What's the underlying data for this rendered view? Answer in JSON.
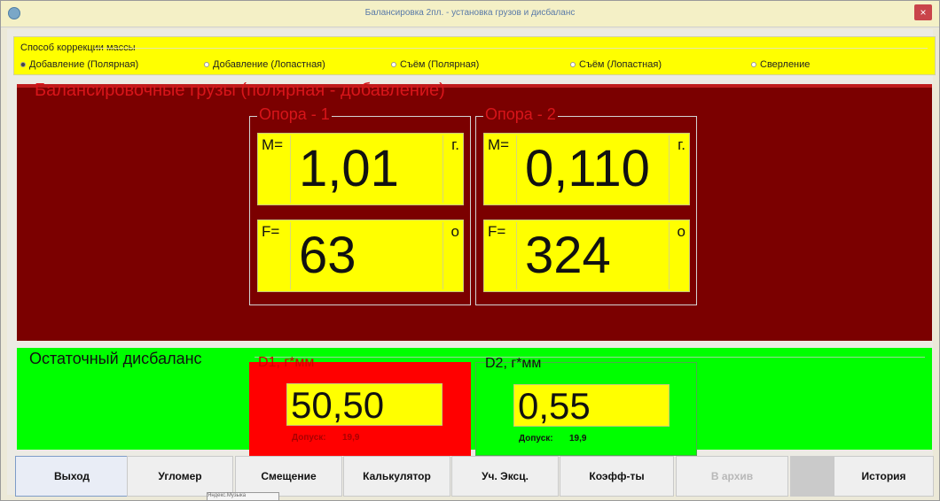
{
  "window": {
    "title": "Балансировка 2пл. - установка грузов и дисбаланс",
    "close_icon": "×"
  },
  "method": {
    "title": "Способ коррекции массы",
    "options": [
      {
        "label": "Добавление (Полярная)",
        "selected": true
      },
      {
        "label": "Добавление (Лопастная)",
        "selected": false
      },
      {
        "label": "Съём (Полярная)",
        "selected": false
      },
      {
        "label": "Съём (Лопастная)",
        "selected": false
      },
      {
        "label": "Сверление",
        "selected": false
      }
    ]
  },
  "weights": {
    "title": "Балансировочные грузы (полярная - добавление)",
    "support1": {
      "title": "Опора - 1",
      "mass": {
        "prefix": "M=",
        "value": "1,01",
        "unit": "г."
      },
      "angle": {
        "prefix": "F=",
        "value": "63",
        "unit": "о"
      }
    },
    "support2": {
      "title": "Опора - 2",
      "mass": {
        "prefix": "M=",
        "value": "0,110",
        "unit": "г."
      },
      "angle": {
        "prefix": "F=",
        "value": "324",
        "unit": "о"
      }
    }
  },
  "residual": {
    "title": "Остаточный дисбаланс",
    "d1": {
      "title": "D1, г*мм",
      "value": "50,50",
      "tolerance_label": "Допуск:",
      "tolerance_value": "19,9"
    },
    "d2": {
      "title": "D2, г*мм",
      "value": "0,55",
      "tolerance_label": "Допуск:",
      "tolerance_value": "19,9"
    }
  },
  "buttons": [
    {
      "label": "Выход"
    },
    {
      "label": "Угломер"
    },
    {
      "label": "Смещение"
    },
    {
      "label": "Калькулятор"
    },
    {
      "label": "Уч. Эксц."
    },
    {
      "label": "Коэфф-ты"
    },
    {
      "label": "В архив"
    },
    {
      "label": "История"
    }
  ],
  "tooltip": {
    "text": "Яндекс.Музыка"
  },
  "colors": {
    "panel_yellow": "#ffff00",
    "panel_dark_red": "#7b0000",
    "panel_green": "#00ff00",
    "panel_red": "#ff0000"
  }
}
